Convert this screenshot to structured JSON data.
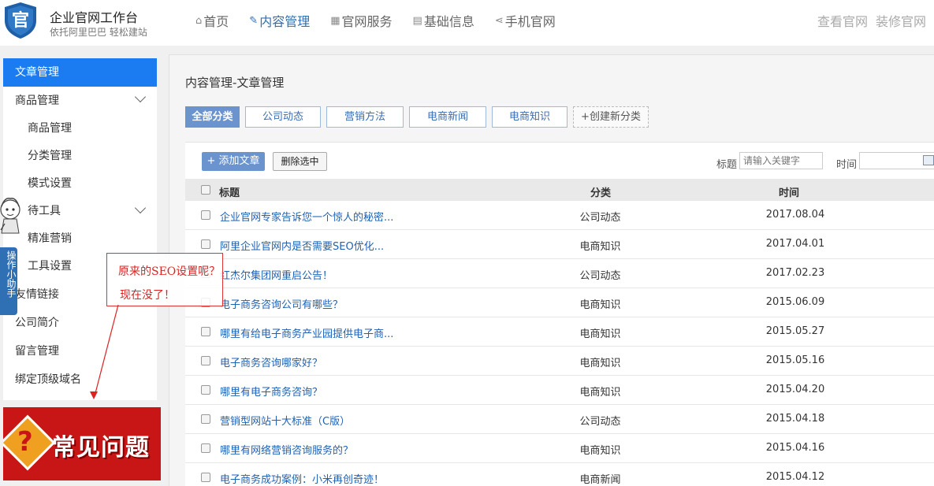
{
  "header": {
    "brand_title": "企业官网工作台",
    "brand_sub": "依托阿里巴巴 轻松建站",
    "logo_char": "官",
    "nav": [
      {
        "icon": "⌂",
        "icon_name": "home-icon",
        "label": "首页",
        "active": false
      },
      {
        "icon": "✎",
        "icon_name": "edit-icon",
        "label": "内容管理",
        "active": true
      },
      {
        "icon": "▦",
        "icon_name": "grid-icon",
        "label": "官网服务",
        "active": false
      },
      {
        "icon": "▤",
        "icon_name": "document-icon",
        "label": "基础信息",
        "active": false
      },
      {
        "icon": "⋖",
        "icon_name": "share-icon",
        "label": "手机官网",
        "active": false
      }
    ],
    "links": [
      "查看官网",
      "装修官网"
    ]
  },
  "sidebar": {
    "items": [
      {
        "label": "文章管理",
        "sub": false,
        "active": true,
        "chev": false
      },
      {
        "label": "商品管理",
        "sub": false,
        "active": false,
        "chev": true
      },
      {
        "label": "商品管理",
        "sub": true,
        "active": false,
        "chev": false
      },
      {
        "label": "分类管理",
        "sub": true,
        "active": false,
        "chev": false
      },
      {
        "label": "模式设置",
        "sub": true,
        "active": false,
        "chev": false
      },
      {
        "label": "待工具",
        "sub": true,
        "active": false,
        "chev": true
      },
      {
        "label": "精准营销",
        "sub": true,
        "active": false,
        "chev": false
      },
      {
        "label": "工具设置",
        "sub": true,
        "active": false,
        "chev": false
      },
      {
        "label": "友情链接",
        "sub": false,
        "active": false,
        "chev": false
      },
      {
        "label": "公司简介",
        "sub": false,
        "active": false,
        "chev": false
      },
      {
        "label": "留言管理",
        "sub": false,
        "active": false,
        "chev": false
      },
      {
        "label": "绑定顶级域名",
        "sub": false,
        "active": false,
        "chev": false
      }
    ],
    "faq_banner": "常见问题",
    "helper_tab": "操作小助手"
  },
  "annotation": {
    "line1": "原来的SEO设置呢？",
    "line2": "现在没了！"
  },
  "main": {
    "breadcrumb": "内容管理-文章管理",
    "categories": [
      {
        "label": "全部分类",
        "active": true
      },
      {
        "label": "公司动态",
        "active": false
      },
      {
        "label": "营销方法",
        "active": false
      },
      {
        "label": "电商新闻",
        "active": false
      },
      {
        "label": "电商知识",
        "active": false
      },
      {
        "label": "+创建新分类",
        "active": false,
        "new": true
      }
    ],
    "add_button": "+ 添加文章",
    "delete_button": "删除选中",
    "filter_title_label": "标题",
    "filter_title_placeholder": "请输入关键字",
    "filter_time_label": "时间",
    "columns": [
      "标题",
      "分类",
      "时间"
    ],
    "rows": [
      {
        "title": "企业官网专家告诉您一个惊人的秘密...",
        "category": "公司动态",
        "date": "2017.08.04"
      },
      {
        "title": "阿里企业官网内是否需要SEO优化...",
        "category": "电商知识",
        "date": "2017.04.01"
      },
      {
        "title": "红杰尔集团网重启公告！",
        "category": "公司动态",
        "date": "2017.02.23"
      },
      {
        "title": "电子商务咨询公司有哪些？",
        "category": "电商知识",
        "date": "2015.06.09"
      },
      {
        "title": "哪里有给电子商务产业园提供电子商...",
        "category": "电商知识",
        "date": "2015.05.27"
      },
      {
        "title": "电子商务咨询哪家好？",
        "category": "电商知识",
        "date": "2015.05.16"
      },
      {
        "title": "哪里有电子商务咨询？",
        "category": "电商知识",
        "date": "2015.04.20"
      },
      {
        "title": "营销型网站十大标准（C版）",
        "category": "公司动态",
        "date": "2015.04.18"
      },
      {
        "title": "哪里有网络营销咨询服务的？",
        "category": "电商知识",
        "date": "2015.04.16"
      },
      {
        "title": "电子商务成功案例：小米再创奇迹！",
        "category": "电商新闻",
        "date": "2015.04.12"
      }
    ]
  },
  "colors": {
    "accent": "#1a7cf0",
    "link": "#1f62b5",
    "category_active": "#6b94cf",
    "annotation": "#d22222"
  }
}
